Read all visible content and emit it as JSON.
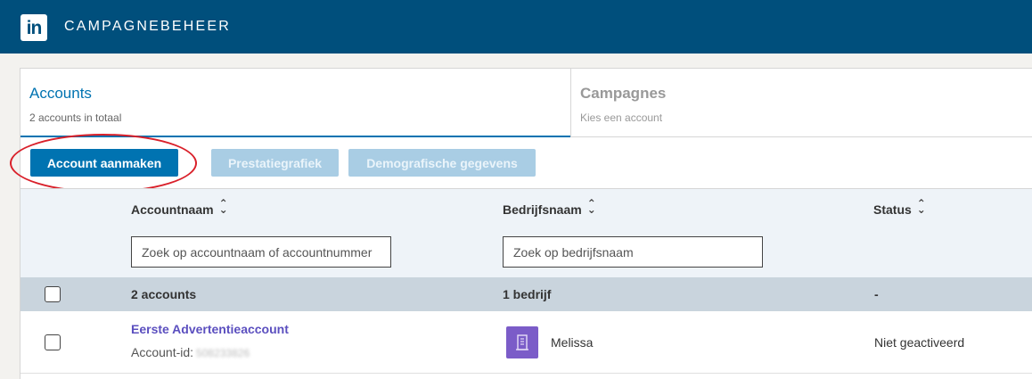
{
  "header": {
    "logo_text": "in",
    "app_title": "CAMPAGNEBEHEER",
    "brand_color": "#004f7c"
  },
  "tabs": [
    {
      "title": "Accounts",
      "subtitle": "2 accounts in totaal",
      "active": true
    },
    {
      "title": "Campagnes",
      "subtitle": "Kies een account",
      "active": false
    }
  ],
  "toolbar": {
    "create_label": "Account aanmaken",
    "performance_label": "Prestatiegrafiek",
    "demographics_label": "Demografische gegevens",
    "accent_color": "#0073b1",
    "highlight_color": "#d9202a"
  },
  "table": {
    "columns": [
      {
        "label": "Accountnaam",
        "filter_placeholder": "Zoek op accountnaam of accountnummer"
      },
      {
        "label": "Bedrijfsnaam",
        "filter_placeholder": "Zoek op bedrijfsnaam"
      },
      {
        "label": "Status"
      }
    ],
    "summary": {
      "accounts": "2 accounts",
      "companies": "1 bedrijf",
      "status": "-"
    },
    "rows": [
      {
        "account_name": "Eerste Advertentieaccount",
        "account_id_label": "Account-id:",
        "account_id": "508233826",
        "company": "Melissa",
        "company_icon": "building-icon",
        "status": "Niet geactiveerd"
      }
    ]
  }
}
